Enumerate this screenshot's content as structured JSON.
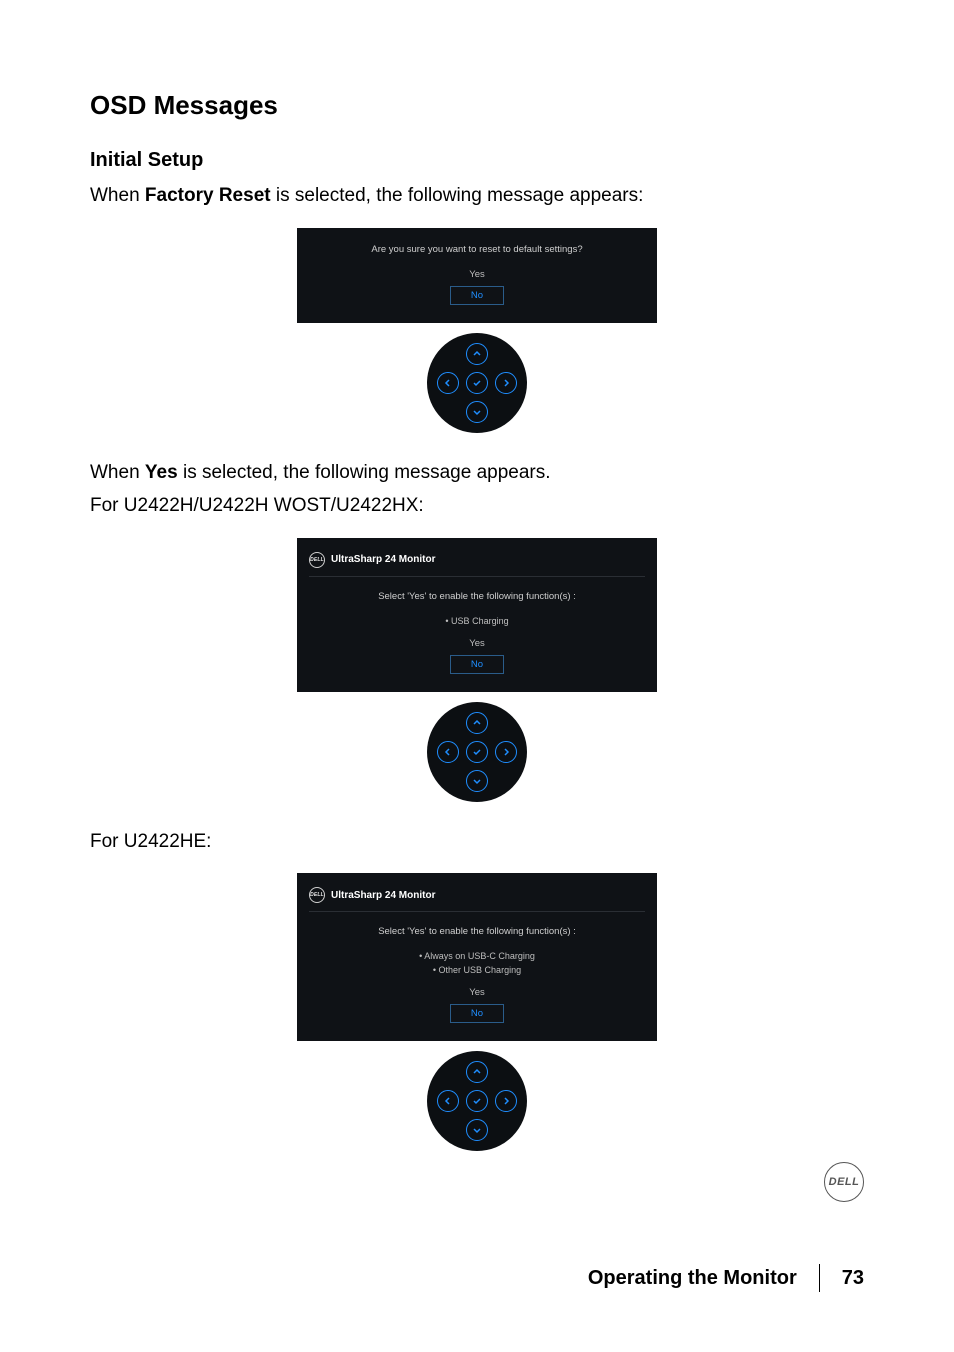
{
  "page": {
    "heading": "OSD Messages",
    "subheading": "Initial Setup",
    "intro_prefix": "When ",
    "intro_bold": "Factory Reset",
    "intro_suffix": " is selected, the following message appears:",
    "yes_line_prefix": "When ",
    "yes_line_bold": "Yes",
    "yes_line_suffix": " is selected, the following message appears.",
    "models_line": "For U2422H/U2422H WOST/U2422HX:",
    "models_line2": "For U2422HE:"
  },
  "osd1": {
    "question": "Are you sure you want to reset to default settings?",
    "yes": "Yes",
    "no": "No"
  },
  "osd2": {
    "title": "UltraSharp 24 Monitor",
    "prompt": "Select 'Yes' to enable the following function(s) :",
    "bullet1": "•  USB Charging",
    "yes": "Yes",
    "no": "No"
  },
  "osd3": {
    "title": "UltraSharp 24 Monitor",
    "prompt": "Select 'Yes' to enable the following function(s) :",
    "bullet1": "• Always on USB-C Charging",
    "bullet2": "• Other USB Charging",
    "yes": "Yes",
    "no": "No"
  },
  "brand": {
    "dell": "DELL"
  },
  "footer": {
    "section": "Operating the Monitor",
    "page": "73"
  }
}
